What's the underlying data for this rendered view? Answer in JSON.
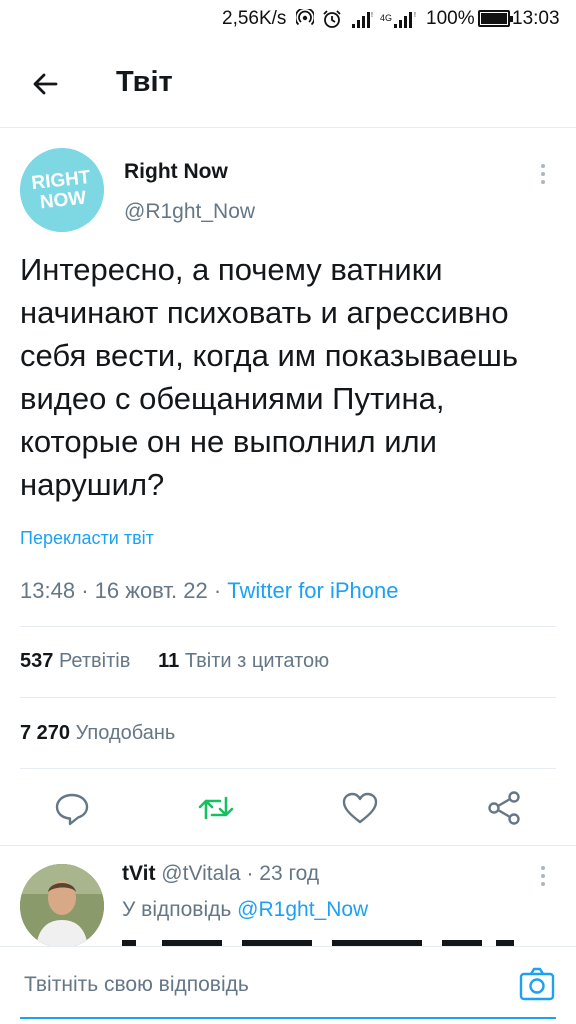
{
  "status_bar": {
    "speed": "2,56K/s",
    "battery_pct": "100%",
    "battery_level": 1.0,
    "time": "13:03",
    "icons": [
      "hotspot-icon",
      "alarm-icon",
      "signal-icon",
      "4g-signal-icon",
      "battery-icon"
    ]
  },
  "header": {
    "title": "Твіт"
  },
  "tweet": {
    "author_name": "Right Now",
    "author_handle": "@R1ght_Now",
    "avatar_text": [
      "RIGHT",
      "NOW"
    ],
    "text": "Интересно, а почему ватники начинают психовать и агрессивно себя вести, когда им показываешь видео с обещаниями Путина, которые он не выполнил или нарушил?",
    "translate_label": "Перекласти твіт",
    "time": "13:48",
    "date": "16 жовт. 22",
    "source": "Twitter for iPhone",
    "retweets_count": "537",
    "retweets_label": "Ретвітів",
    "quotes_count": "11",
    "quotes_label": "Твіти з цитатою",
    "likes_count": "7 270",
    "likes_label": "Уподобань"
  },
  "actions": [
    "reply-icon",
    "retweet-icon",
    "like-icon",
    "share-icon"
  ],
  "reply": {
    "name": "tVit",
    "handle": "@tVitala",
    "age": "23 год",
    "reply_to_prefix": "У відповідь",
    "reply_to_handle": "@R1ght_Now"
  },
  "compose": {
    "placeholder": "Твітніть свою відповідь"
  },
  "colors": {
    "accent": "#1da1f2",
    "retweet": "#17bf63",
    "muted": "#657786",
    "text": "#14171a",
    "divider": "#e6ecf0"
  }
}
